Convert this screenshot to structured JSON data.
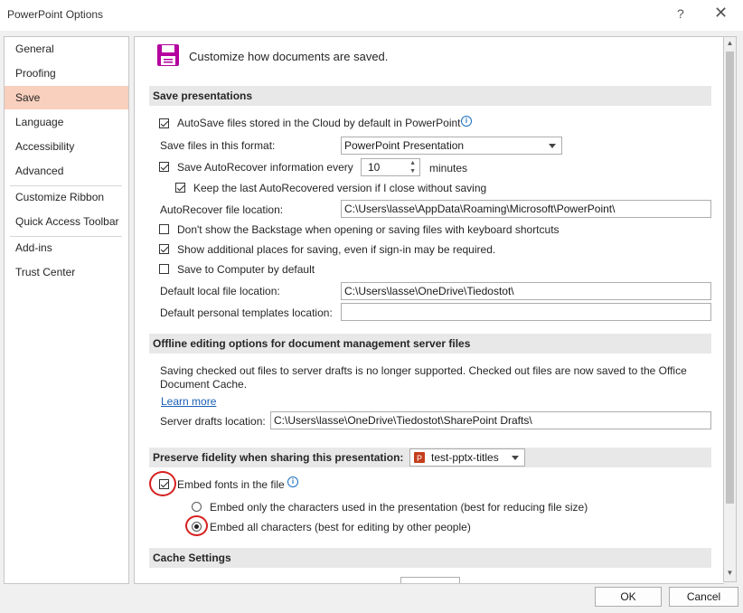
{
  "window": {
    "title": "PowerPoint Options",
    "help_glyph": "?",
    "close_glyph": "✕"
  },
  "sidebar": {
    "items": [
      {
        "label": "General"
      },
      {
        "label": "Proofing"
      },
      {
        "label": "Save",
        "selected": true
      },
      {
        "label": "Language"
      },
      {
        "label": "Accessibility"
      },
      {
        "label": "Advanced"
      },
      {
        "label": "Customize Ribbon"
      },
      {
        "label": "Quick Access Toolbar"
      },
      {
        "label": "Add-ins"
      },
      {
        "label": "Trust Center"
      }
    ]
  },
  "header": {
    "text": "Customize how documents are saved.",
    "icon": "save-floppy-icon",
    "icon_color": "#b4009e"
  },
  "save_presentations": {
    "heading": "Save presentations",
    "autosave_label": "AutoSave files stored in the Cloud by default in PowerPoint",
    "autosave_checked": true,
    "format_label": "Save files in this format:",
    "format_value": "PowerPoint Presentation",
    "autorecover_label": "Save AutoRecover information every",
    "autorecover_checked": true,
    "autorecover_minutes": "10",
    "minutes_label": "minutes",
    "keep_last_label": "Keep the last AutoRecovered version if I close without saving",
    "keep_last_checked": true,
    "autorecover_location_label": "AutoRecover file location:",
    "autorecover_location_value": "C:\\Users\\lasse\\AppData\\Roaming\\Microsoft\\PowerPoint\\",
    "backstage_label": "Don't show the Backstage when opening or saving files with keyboard shortcuts",
    "backstage_checked": false,
    "additional_places_label": "Show additional places for saving, even if sign-in may be required.",
    "additional_places_checked": true,
    "save_to_computer_label": "Save to Computer by default",
    "save_to_computer_checked": false,
    "default_local_label": "Default local file location:",
    "default_local_value": "C:\\Users\\lasse\\OneDrive\\Tiedostot\\",
    "templates_label": "Default personal templates location:",
    "templates_value": ""
  },
  "offline": {
    "heading": "Offline editing options for document management server files",
    "notice_line1": "Saving checked out files to server drafts is no longer supported. Checked out files are now saved to the Office",
    "notice_line2": "Document Cache.",
    "learn_more": "Learn more",
    "drafts_label": "Server drafts location:",
    "drafts_value": "C:\\Users\\lasse\\OneDrive\\Tiedostot\\SharePoint Drafts\\"
  },
  "fidelity": {
    "heading": "Preserve fidelity when sharing this presentation:",
    "presentation_select": "test-pptx-titles",
    "embed_fonts_label": "Embed fonts in the file",
    "embed_fonts_checked": true,
    "embed_only_label": "Embed only the characters used in the presentation (best for reducing file size)",
    "embed_all_label": "Embed all characters (best for editing by other people)",
    "selected_option": "embed_all",
    "highlight_color": "#d61f1f"
  },
  "cache": {
    "heading": "Cache Settings"
  },
  "footer": {
    "ok": "OK",
    "cancel": "Cancel"
  }
}
